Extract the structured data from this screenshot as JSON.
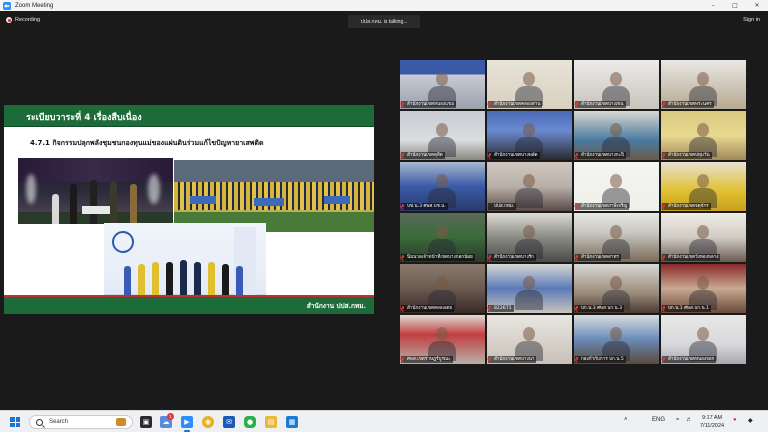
{
  "window": {
    "title": "Zoom Meeting"
  },
  "meeting": {
    "recording_label": "Recording",
    "talking_indicator": "ปปส.กทม. is talking...",
    "signin_label": "Sign in"
  },
  "slide": {
    "header": "ระเบียบวาระที่ 4  เรื่องสืบเนื่อง",
    "subtitle": "4.7.1 กิจกรรมปลุกพลังชุมชนกองทุนแม่ของแผ่นดินร่วมแก้ไขปัญหายาเสพติด",
    "footer": "สำนักงาน ปปส.กทม."
  },
  "gallery": {
    "tiles": [
      {
        "name": "สำนักงานเขตหนองแขม",
        "scene": "banner-blue",
        "muted": true,
        "active": false
      },
      {
        "name": "สำนักงานเขตคลองสาน",
        "scene": "person-logo",
        "muted": true,
        "active": false
      },
      {
        "name": "สำนักงานเขตบางเขน",
        "scene": "room-white",
        "muted": true,
        "active": false
      },
      {
        "name": "สำนักงานเขตพระนคร",
        "scene": "room-people",
        "muted": true,
        "active": false
      },
      {
        "name": "สำนักงานเขตดุสิต",
        "scene": "room-light",
        "muted": true,
        "active": false
      },
      {
        "name": "สำนักงานเขตบางพลัด",
        "scene": "person-center",
        "muted": true,
        "active": false
      },
      {
        "name": "สำนักงานเขตบางกะปิ",
        "scene": "meeting-room",
        "muted": true,
        "active": false
      },
      {
        "name": "สำนักงานเขตปทุมวัน",
        "scene": "yellow-room",
        "muted": true,
        "active": false
      },
      {
        "name": "บช.น.3 ศพส.บช.น.",
        "scene": "poster-blue",
        "muted": true,
        "active": false
      },
      {
        "name": "ปปส.กทม.",
        "scene": "person-poster",
        "muted": false,
        "active": true
      },
      {
        "name": "สำนักงานเขตภาษีเจริญ",
        "scene": "green-text",
        "muted": true,
        "active": false
      },
      {
        "name": "สำนักงานเขตจตุจักร",
        "scene": "person-yellow",
        "muted": true,
        "active": false
      },
      {
        "name": "นิ่มนวลเจ้าหน้าที่เขตบางกอกน้อย",
        "scene": "person-green",
        "muted": true,
        "active": false
      },
      {
        "name": "สำนักงานเขตบางรัก",
        "scene": "screen-room",
        "muted": true,
        "active": false
      },
      {
        "name": "สำนักงานเขตสาทร",
        "scene": "conference",
        "muted": true,
        "active": false
      },
      {
        "name": "สำนักงานเขตวังทองหลาง",
        "scene": "person-office",
        "muted": true,
        "active": false
      },
      {
        "name": "สำนักงานเขตคลองเตย",
        "scene": "person-dark",
        "muted": true,
        "active": false
      },
      {
        "name": "822671",
        "scene": "blue-banner",
        "muted": true,
        "active": false
      },
      {
        "name": "บก.น.3 ศพส.บก.น.3",
        "scene": "long-table",
        "muted": true,
        "active": false
      },
      {
        "name": "บก.น.1 ศพส.บก.น.1",
        "scene": "red-hall",
        "muted": true,
        "active": false
      },
      {
        "name": "ศพส.เขตราษฎร์บูรณะ",
        "scene": "office-red",
        "muted": true,
        "active": false
      },
      {
        "name": "สำนักงานเขตบางนา",
        "scene": "office-plain",
        "muted": true,
        "active": false
      },
      {
        "name": "กองกำกับการ บก.น.5",
        "scene": "table-room",
        "muted": true,
        "active": false
      },
      {
        "name": "สำนักงานเขตหนองจอก",
        "scene": "person-woman",
        "muted": true,
        "active": false
      }
    ]
  },
  "taskbar": {
    "search_placeholder": "Search",
    "notification_badge": "1",
    "language": "ENG",
    "time": "9:17 AM",
    "date": "7/11/2024"
  },
  "colors": {
    "slide_green": "#1e6b3a",
    "active_speaker": "#7ecb3a",
    "muted_red": "#e43a3a",
    "zoom_blue": "#2d8cff"
  }
}
